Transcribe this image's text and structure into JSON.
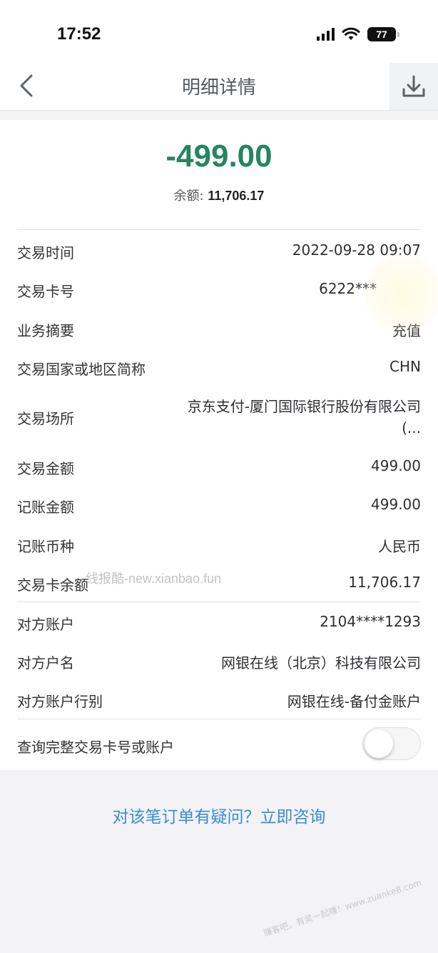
{
  "status": {
    "time": "17:52",
    "battery": "77"
  },
  "nav": {
    "title": "明细详情",
    "back_icon": "chevron-left-icon",
    "download_icon": "download-icon"
  },
  "summary": {
    "amount": "-499.00",
    "balance_label": "余额:",
    "balance_value": "11,706.17",
    "amount_color": "#25855e"
  },
  "details": [
    {
      "label": "交易时间",
      "value": "2022-09-28 09:07"
    },
    {
      "label": "交易卡号",
      "value": "6222***"
    },
    {
      "label": "业务摘要",
      "value": "充值"
    },
    {
      "label": "交易国家或地区简称",
      "value": "CHN"
    },
    {
      "label": "交易场所",
      "value": "京东支付-厦门国际银行股份有限公司(..."
    },
    {
      "label": "交易金额",
      "value": "499.00"
    },
    {
      "label": "记账金额",
      "value": "499.00"
    },
    {
      "label": "记账币种",
      "value": "人民币"
    },
    {
      "label": "交易卡余额",
      "value": "11,706.17"
    },
    {
      "label": "对方账户",
      "value": "2104****1293"
    },
    {
      "label": "对方户名",
      "value": "网银在线（北京）科技有限公司"
    },
    {
      "label": "对方账户行别",
      "value": "网银在线-备付金账户"
    }
  ],
  "toggle_row": {
    "label": "查询完整交易卡号或账户",
    "enabled": false
  },
  "consult_link": "对该笔订单有疑问？立即咨询",
  "watermark": "线报酷-new.xianbao.fun",
  "stamp": "赚客吧，有奖一起赚！www.zuanke8.com",
  "accent_color": "#3b8dd0"
}
